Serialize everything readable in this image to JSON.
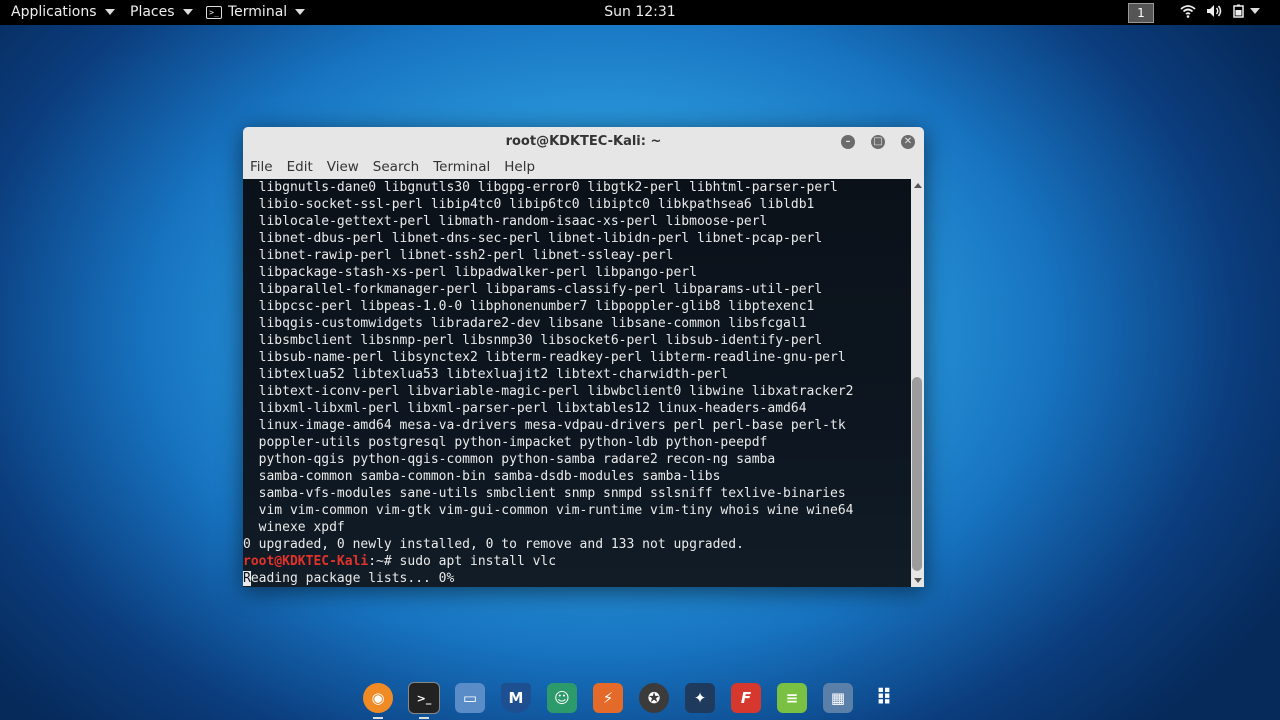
{
  "topbar": {
    "applications": "Applications",
    "places": "Places",
    "terminal": "Terminal",
    "clock": "Sun 12:31",
    "workspace": "1",
    "tray_icons": [
      "wifi-icon",
      "volume-icon",
      "battery-icon",
      "power-icon"
    ]
  },
  "window": {
    "title": "root@KDKTEC-Kali: ~",
    "menu": [
      "File",
      "Edit",
      "View",
      "Search",
      "Terminal",
      "Help"
    ]
  },
  "terminal": {
    "output": [
      "  libgnutls-dane0 libgnutls30 libgpg-error0 libgtk2-perl libhtml-parser-perl",
      "  libio-socket-ssl-perl libip4tc0 libip6tc0 libiptc0 libkpathsea6 libldb1",
      "  liblocale-gettext-perl libmath-random-isaac-xs-perl libmoose-perl",
      "  libnet-dbus-perl libnet-dns-sec-perl libnet-libidn-perl libnet-pcap-perl",
      "  libnet-rawip-perl libnet-ssh2-perl libnet-ssleay-perl",
      "  libpackage-stash-xs-perl libpadwalker-perl libpango-perl",
      "  libparallel-forkmanager-perl libparams-classify-perl libparams-util-perl",
      "  libpcsc-perl libpeas-1.0-0 libphonenumber7 libpoppler-glib8 libptexenc1",
      "  libqgis-customwidgets libradare2-dev libsane libsane-common libsfcgal1",
      "  libsmbclient libsnmp-perl libsnmp30 libsocket6-perl libsub-identify-perl",
      "  libsub-name-perl libsynctex2 libterm-readkey-perl libterm-readline-gnu-perl",
      "  libtexlua52 libtexlua53 libtexluajit2 libtext-charwidth-perl",
      "  libtext-iconv-perl libvariable-magic-perl libwbclient0 libwine libxatracker2",
      "  libxml-libxml-perl libxml-parser-perl libxtables12 linux-headers-amd64",
      "  linux-image-amd64 mesa-va-drivers mesa-vdpau-drivers perl perl-base perl-tk",
      "  poppler-utils postgresql python-impacket python-ldb python-peepdf",
      "  python-qgis python-qgis-common python-samba radare2 recon-ng samba",
      "  samba-common samba-common-bin samba-dsdb-modules samba-libs",
      "  samba-vfs-modules sane-utils smbclient snmp snmpd sslsniff texlive-binaries",
      "  vim vim-common vim-gtk vim-gui-common vim-runtime vim-tiny whois wine wine64",
      "  winexe xpdf",
      "0 upgraded, 0 newly installed, 0 to remove and 133 not upgraded."
    ],
    "prompt_user": "root@KDKTEC-Kali",
    "prompt_rest": ":~# ",
    "command": "sudo apt install vlc",
    "status_cursor_char": "R",
    "status_rest": "eading package lists... 0%"
  },
  "dock": {
    "apps": [
      {
        "name": "firefox-icon",
        "color": "#f08a24",
        "glyph": "◉"
      },
      {
        "name": "terminal-icon",
        "color": "#222222",
        "glyph": ">_"
      },
      {
        "name": "files-icon",
        "color": "#5a8cc8",
        "glyph": "▭"
      },
      {
        "name": "metasploit-icon",
        "color": "#1d4f91",
        "glyph": "M"
      },
      {
        "name": "armitage-icon",
        "color": "#2c9a6a",
        "glyph": "☺"
      },
      {
        "name": "burpsuite-icon",
        "color": "#e46a2a",
        "glyph": "⚡"
      },
      {
        "name": "maltego-icon",
        "color": "#3b3b3b",
        "glyph": "✪"
      },
      {
        "name": "beef-icon",
        "color": "#1e3a5c",
        "glyph": "✦"
      },
      {
        "name": "faraday-icon",
        "color": "#d6382d",
        "glyph": "F"
      },
      {
        "name": "leafpad-icon",
        "color": "#7ac143",
        "glyph": "≡"
      },
      {
        "name": "sysmonitor-icon",
        "color": "#5a7fa8",
        "glyph": "▦"
      },
      {
        "name": "app-grid-icon",
        "color": "transparent",
        "glyph": "⠿"
      }
    ]
  }
}
